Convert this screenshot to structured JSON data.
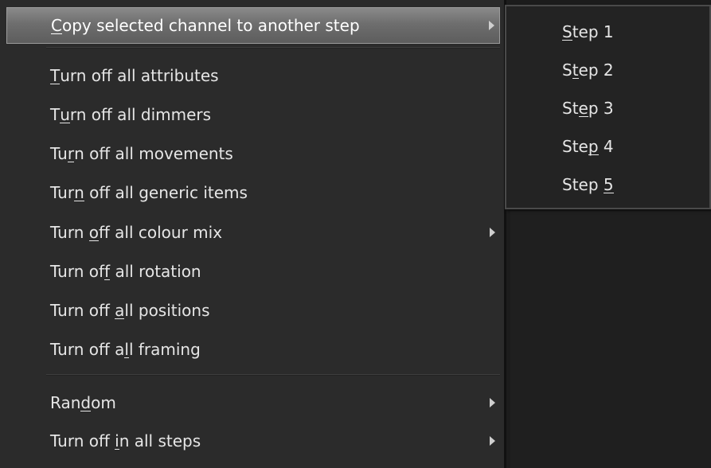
{
  "menu": {
    "items": [
      {
        "pre": "",
        "key": "C",
        "post": "opy selected channel to another step",
        "submenu": true,
        "highlighted": true
      },
      {
        "pre": "",
        "key": "T",
        "post": "urn off all attributes",
        "submenu": false
      },
      {
        "pre": "T",
        "key": "u",
        "post": "rn off all dimmers",
        "submenu": false
      },
      {
        "pre": "Tu",
        "key": "r",
        "post": "n off all movements",
        "submenu": false
      },
      {
        "pre": "Tur",
        "key": "n",
        "post": " off all generic items",
        "submenu": false
      },
      {
        "pre": "Turn ",
        "key": "o",
        "post": "ff all colour mix",
        "submenu": true
      },
      {
        "pre": "Turn of",
        "key": "f",
        "post": " all rotation",
        "submenu": false
      },
      {
        "pre": "Turn off ",
        "key": "a",
        "post": "ll positions",
        "submenu": false
      },
      {
        "pre": "Turn off a",
        "key": "l",
        "post": "l framing",
        "submenu": false
      },
      {
        "pre": "Ran",
        "key": "d",
        "post": "om",
        "submenu": true
      },
      {
        "pre": "Turn off ",
        "key": "i",
        "post": "n all steps",
        "submenu": true
      }
    ]
  },
  "submenu": {
    "items": [
      {
        "pre": "",
        "key": "S",
        "post": "tep 1"
      },
      {
        "pre": "S",
        "key": "t",
        "post": "ep 2"
      },
      {
        "pre": "St",
        "key": "e",
        "post": "p 3"
      },
      {
        "pre": "Ste",
        "key": "p",
        "post": " 4"
      },
      {
        "pre": "Step ",
        "key": "5",
        "post": ""
      }
    ]
  }
}
